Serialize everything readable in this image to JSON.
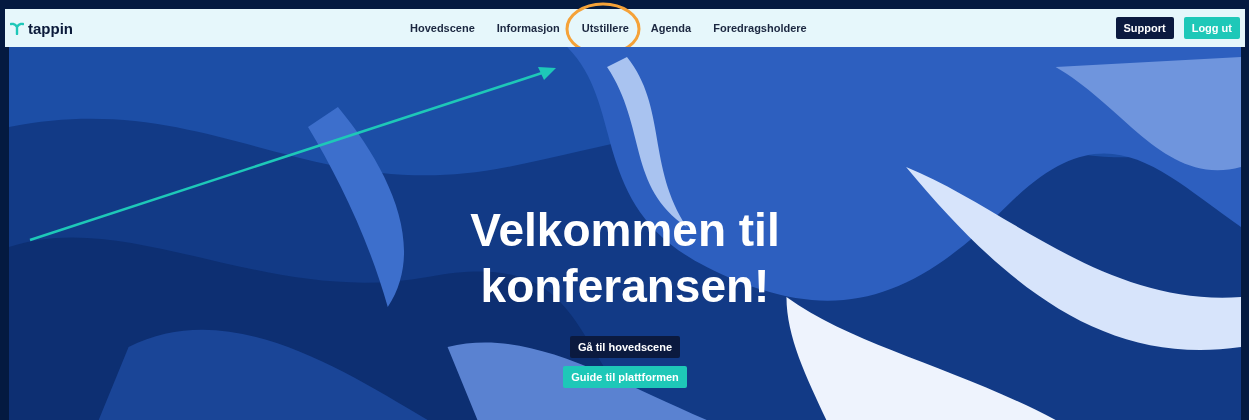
{
  "header": {
    "logo": "tappin",
    "nav": [
      {
        "label": "Hovedscene",
        "highlighted": false
      },
      {
        "label": "Informasjon",
        "highlighted": false
      },
      {
        "label": "Utstillere",
        "highlighted": true
      },
      {
        "label": "Agenda",
        "highlighted": false
      },
      {
        "label": "Foredragsholdere",
        "highlighted": false
      }
    ],
    "buttons": [
      {
        "label": "Support",
        "kind": "dark"
      },
      {
        "label": "Logg ut",
        "kind": "teal"
      }
    ]
  },
  "hero": {
    "title_lines": [
      "Velkommen til",
      "konferansen!"
    ],
    "buttons": [
      {
        "label": "Gå til hovedscene",
        "kind": "dark"
      },
      {
        "label": "Guide til plattformen",
        "kind": "teal"
      }
    ]
  }
}
